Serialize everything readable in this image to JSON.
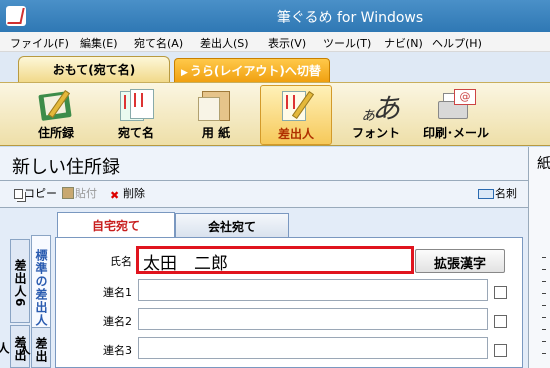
{
  "window": {
    "title": "筆ぐるめ for Windows"
  },
  "menu": [
    "ファイル(F)",
    "編集(E)",
    "宛て名(A)",
    "差出人(S)",
    "表示(V)",
    "ツール(T)",
    "ナビ(N)",
    "ヘルプ(H)"
  ],
  "mode_tabs": {
    "front": "おもて(宛て名)",
    "back": "うら(レイアウト)へ切替"
  },
  "toolbar": {
    "address_book": "住所録",
    "atena": "宛て名",
    "paper": "用 紙",
    "sender": "差出人",
    "font": "フォント",
    "print_mail": "印刷･メール"
  },
  "section": {
    "title": "新しい住所録"
  },
  "subtools": {
    "copy": "コピー",
    "paste": "貼付",
    "delete": "削除",
    "meishi": "名刺"
  },
  "side_tabs": {
    "sender6": "差出人6",
    "standard": "標準の差出人",
    "sender5": "差出人"
  },
  "form_tabs": {
    "home": "自宅宛て",
    "company": "会社宛て"
  },
  "form": {
    "name_label": "氏名",
    "name_value": "太田　二郎",
    "expand_kanji": "拡張漢字",
    "renmei1": "連名1",
    "renmei2": "連名2",
    "renmei3": "連名3"
  },
  "right_pane": {
    "label": "紙"
  },
  "colors": {
    "titlebar": "#2f78b4",
    "highlight_border": "#e0141e",
    "active_tab_text": "#c81e1e",
    "front_tab": "#f1d98a",
    "back_tab": "#f0a010"
  },
  "icons": [
    "app-icon",
    "address-book-icon",
    "atena-icon",
    "paper-icon",
    "sender-icon",
    "font-icon",
    "print-mail-icon",
    "copy-icon",
    "paste-icon",
    "delete-icon",
    "meishi-icon"
  ]
}
